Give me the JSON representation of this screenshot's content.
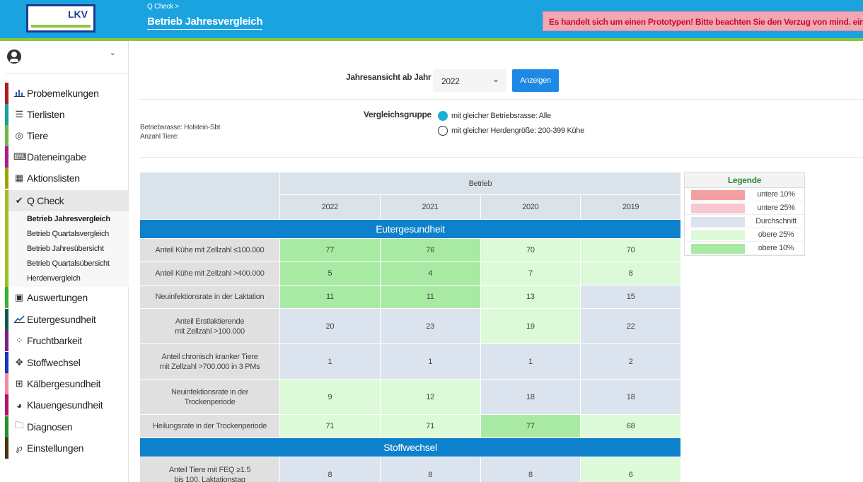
{
  "header": {
    "logo_text": "LKV",
    "breadcrumb_parent": "Q Check >",
    "title": "Betrieb Jahresvergleich",
    "banner": "Es handelt sich um einen Prototypen! Bitte beachten Sie den Verzug von mind. einem T"
  },
  "sidebar": {
    "items": [
      {
        "label": "Probemelkungen",
        "icon": "bar-chart-icon",
        "color": "#b01c1c"
      },
      {
        "label": "Tierlisten",
        "icon": "list-icon",
        "color": "#1a9e9e"
      },
      {
        "label": "Tiere",
        "icon": "target-icon",
        "color": "#6dbb4b"
      },
      {
        "label": "Dateneingabe",
        "icon": "keyboard-icon",
        "color": "#b0198c"
      },
      {
        "label": "Aktionslisten",
        "icon": "calendar-icon",
        "color": "#a1a400"
      },
      {
        "label": "Q Check",
        "icon": "check-icon",
        "color": "#9fbf1f"
      },
      {
        "label": "Auswertungen",
        "icon": "report-icon",
        "color": "#37b233"
      },
      {
        "label": "Eutergesundheit",
        "icon": "trend-icon",
        "color": "#0b5a52"
      },
      {
        "label": "Fruchtbarkeit",
        "icon": "dots-circle-icon",
        "color": "#7c1d8a"
      },
      {
        "label": "Stoffwechsel",
        "icon": "arrows-icon",
        "color": "#1a33c0"
      },
      {
        "label": "Kälbergesundheit",
        "icon": "plus-box-icon",
        "color": "#f08aa5"
      },
      {
        "label": "Klauengesundheit",
        "icon": "pie-icon",
        "color": "#b8106c"
      },
      {
        "label": "Diagnosen",
        "icon": "folder-icon",
        "color": "#23912c"
      },
      {
        "label": "Einstellungen",
        "icon": "settings-icon",
        "color": "#4a3410"
      }
    ],
    "sub_items": [
      "Betrieb Jahresvergleich",
      "Betrieb Quartalsvergleich",
      "Betrieb Jahresübersicht",
      "Betrieb Quartalsübersicht",
      "Herdenvergleich"
    ]
  },
  "filter": {
    "label": "Jahresansicht ab Jahr",
    "year": "2022",
    "button": "Anzeigen"
  },
  "info": {
    "breed": "Betriebsrasse: Holstein-Sbt",
    "count": "Anzahl Tiere:"
  },
  "compare": {
    "label": "Vergleichsgruppe",
    "option1": "mit gleicher Betriebsrasse: Alle",
    "option2": "mit gleicher Herdengröße: 200-399 Kühe"
  },
  "table": {
    "group_header": "Betrieb",
    "years": [
      "2022",
      "2021",
      "2020",
      "2019"
    ],
    "section1": "Eutergesundheit",
    "section2": "Stoffwechsel",
    "rows": [
      {
        "label1": "Anteil Kühe mit Zellzahl ≤100.000",
        "label2": "",
        "values": [
          "77",
          "76",
          "70",
          "70"
        ],
        "classes": [
          "o10",
          "o10",
          "o25",
          "o25"
        ]
      },
      {
        "label1": "Anteil Kühe mit Zellzahl >400.000",
        "label2": "",
        "values": [
          "5",
          "4",
          "7",
          "8"
        ],
        "classes": [
          "o10",
          "o10",
          "o25",
          "o25"
        ]
      },
      {
        "label1": "Neuinfektionsrate in der Laktation",
        "label2": "",
        "values": [
          "11",
          "11",
          "13",
          "15"
        ],
        "classes": [
          "o10",
          "o10",
          "o25",
          "avg"
        ]
      },
      {
        "label1": "Anteil Erstlaktierende",
        "label2": "mit Zellzahl >100.000",
        "values": [
          "20",
          "23",
          "19",
          "22"
        ],
        "classes": [
          "avg",
          "avg",
          "o25",
          "avg"
        ]
      },
      {
        "label1": "Anteil chronisch kranker Tiere",
        "label2": "mit Zellzahl >700.000 in 3 PMs",
        "values": [
          "1",
          "1",
          "1",
          "2"
        ],
        "classes": [
          "avg",
          "avg",
          "avg",
          "avg"
        ]
      },
      {
        "label1": "Neuinfektionsrate in der",
        "label2": "Trockenperiode",
        "values": [
          "9",
          "12",
          "18",
          "18"
        ],
        "classes": [
          "o25",
          "o25",
          "avg",
          "avg"
        ]
      },
      {
        "label1": "Heilungsrate in der Trockenperiode",
        "label2": "",
        "values": [
          "71",
          "71",
          "77",
          "68"
        ],
        "classes": [
          "o25",
          "o25",
          "o10",
          "o25"
        ]
      }
    ],
    "row_stoff": {
      "label1": "Anteil Tiere mit FEQ ≥1.5",
      "label2": "bis 100. Laktationstag",
      "values": [
        "8",
        "8",
        "8",
        "6"
      ],
      "classes": [
        "avg",
        "avg",
        "avg",
        "o25"
      ]
    }
  },
  "legend": {
    "title": "Legende",
    "items": [
      {
        "label": "untere 10%",
        "color": "#f4a0a0"
      },
      {
        "label": "untere 25%",
        "color": "#f8c8cf"
      },
      {
        "label": "Durchschnitt",
        "color": "#dbe3ee"
      },
      {
        "label": "obere 25%",
        "color": "#dcfad8"
      },
      {
        "label": "obere 10%",
        "color": "#a8eaa4"
      }
    ]
  }
}
